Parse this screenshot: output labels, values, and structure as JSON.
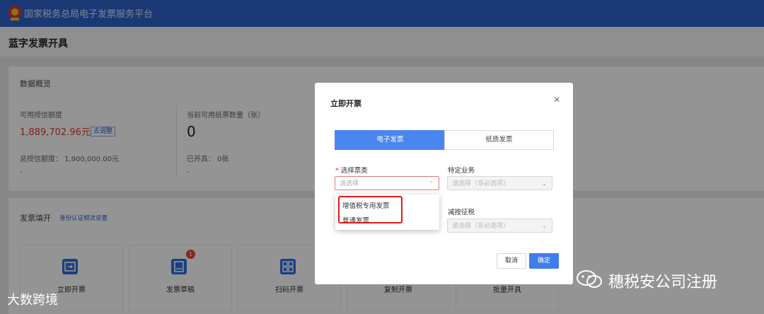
{
  "header": {
    "app_title": "国家税务总局电子发票服务平台",
    "logo_icon": "tax-emblem-icon"
  },
  "page": {
    "title": "蓝字发票开具"
  },
  "overview": {
    "section_title": "数据概览",
    "available_credit_label": "可用授信额度",
    "available_credit_value": "1,889,702.96元",
    "adjust_tag": "去调整",
    "total_credit_text": "总授信额度： 1,900,000.00元",
    "dash1": "-",
    "paper_count_label": "当前可用纸票数量（张）",
    "paper_count_value": "0",
    "issued_text": "已开具： 0张",
    "dash2": "-"
  },
  "fill": {
    "section_title": "发票填开",
    "identity_link": "身份认证频次设置",
    "tiles": [
      {
        "label": "立即开票",
        "icon": "invoice-scan-icon"
      },
      {
        "label": "发票草稿",
        "icon": "draft-icon",
        "badge": "1"
      },
      {
        "label": "扫码开票",
        "icon": "qr-grid-icon"
      },
      {
        "label": "复制开票"
      },
      {
        "label": "批量开具"
      }
    ]
  },
  "modal": {
    "title": "立即开票",
    "close_icon": "close-icon",
    "tabs": [
      "电子发票",
      "纸质发票"
    ],
    "active_tab": "电子发票",
    "invoice_type_label": "选择票类",
    "invoice_type_placeholder": "请选择",
    "special_business_label": "特定业务",
    "special_business_placeholder": "请选择（非必选项）",
    "reduce_label": "减按征税",
    "reduce_placeholder": "请选择（非必选项）",
    "dropdown_options": [
      "增值税专用发票",
      "普通发票"
    ],
    "cancel_label": "取消",
    "confirm_label": "确定"
  },
  "watermarks": {
    "left": "大数跨境",
    "right": "穗税安公司注册"
  },
  "colors": {
    "brand_blue": "#2e62c8",
    "accent_blue": "#4a86f0",
    "error_red": "#e01a1a",
    "amount_red": "#d9392b"
  }
}
